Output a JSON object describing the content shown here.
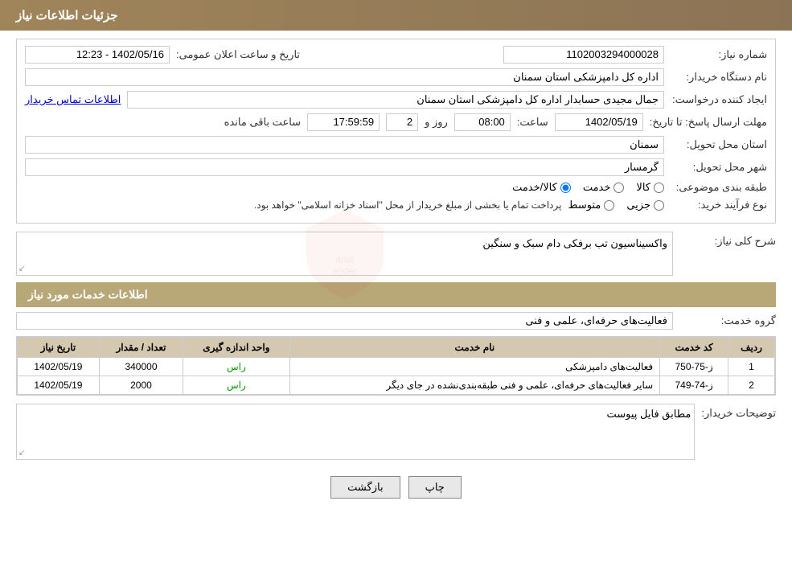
{
  "page": {
    "title": "جزئیات اطلاعات نیاز"
  },
  "header": {
    "title": "جزئیات اطلاعات نیاز"
  },
  "fields": {
    "need_number_label": "شماره نیاز:",
    "need_number_value": "1102003294000028",
    "date_label": "تاریخ و ساعت اعلان عمومی:",
    "date_value": "1402/05/16 - 12:23",
    "buyer_org_label": "نام دستگاه خریدار:",
    "buyer_org_value": "اداره کل دامپزشکی استان سمنان",
    "creator_label": "ایجاد کننده درخواست:",
    "creator_value": "جمال مجیدی حسابدار اداره کل دامپزشکی استان سمنان",
    "contact_link": "اطلاعات تماس خریدار",
    "deadline_label": "مهلت ارسال پاسخ: تا تاریخ:",
    "deadline_date": "1402/05/19",
    "deadline_time_label": "ساعت:",
    "deadline_time": "08:00",
    "deadline_days_label": "روز و",
    "deadline_days": "2",
    "deadline_remaining_label": "ساعت باقی مانده",
    "deadline_remaining": "17:59:59",
    "province_label": "استان محل تحویل:",
    "province_value": "سمنان",
    "city_label": "شهر محل تحویل:",
    "city_value": "گرمسار",
    "category_label": "طبقه بندی موضوعی:",
    "radio_options": [
      "کالا",
      "خدمت",
      "کالا/خدمت"
    ],
    "radio_selected": "کالا/خدمت",
    "purchase_type_label": "نوع فرآیند خرید:",
    "purchase_options": [
      "جزیی",
      "متوسط"
    ],
    "purchase_note": "پرداخت تمام یا بخشی از مبلغ خریدار از محل \"اسناد خزانه اسلامی\" خواهد بود.",
    "need_desc_label": "شرح کلی نیاز:",
    "need_desc_value": "واکسیناسیون تب برفکی دام سبک و سنگین",
    "services_section_title": "اطلاعات خدمات مورد نیاز",
    "service_group_label": "گروه خدمت:",
    "service_group_value": "فعالیت‌های حرفه‌ای، علمی و فنی",
    "table": {
      "columns": [
        "ردیف",
        "کد خدمت",
        "نام خدمت",
        "واحد اندازه گیری",
        "تعداد / مقدار",
        "تاریخ نیاز"
      ],
      "rows": [
        {
          "num": "1",
          "code": "ز-75-750",
          "name": "فعالیت‌های دامپزشکی",
          "unit": "راس",
          "qty": "340000",
          "date": "1402/05/19"
        },
        {
          "num": "2",
          "code": "ز-74-749",
          "name": "سایر فعالیت‌های حرفه‌ای، علمی و فنی طبقه‌بندی‌نشده در جای دیگر",
          "unit": "راس",
          "qty": "2000",
          "date": "1402/05/19"
        }
      ]
    },
    "buyer_desc_label": "توضیحات خریدار:",
    "buyer_desc_value": "مطابق فایل پیوست"
  },
  "buttons": {
    "print_label": "چاپ",
    "back_label": "بازگشت"
  }
}
